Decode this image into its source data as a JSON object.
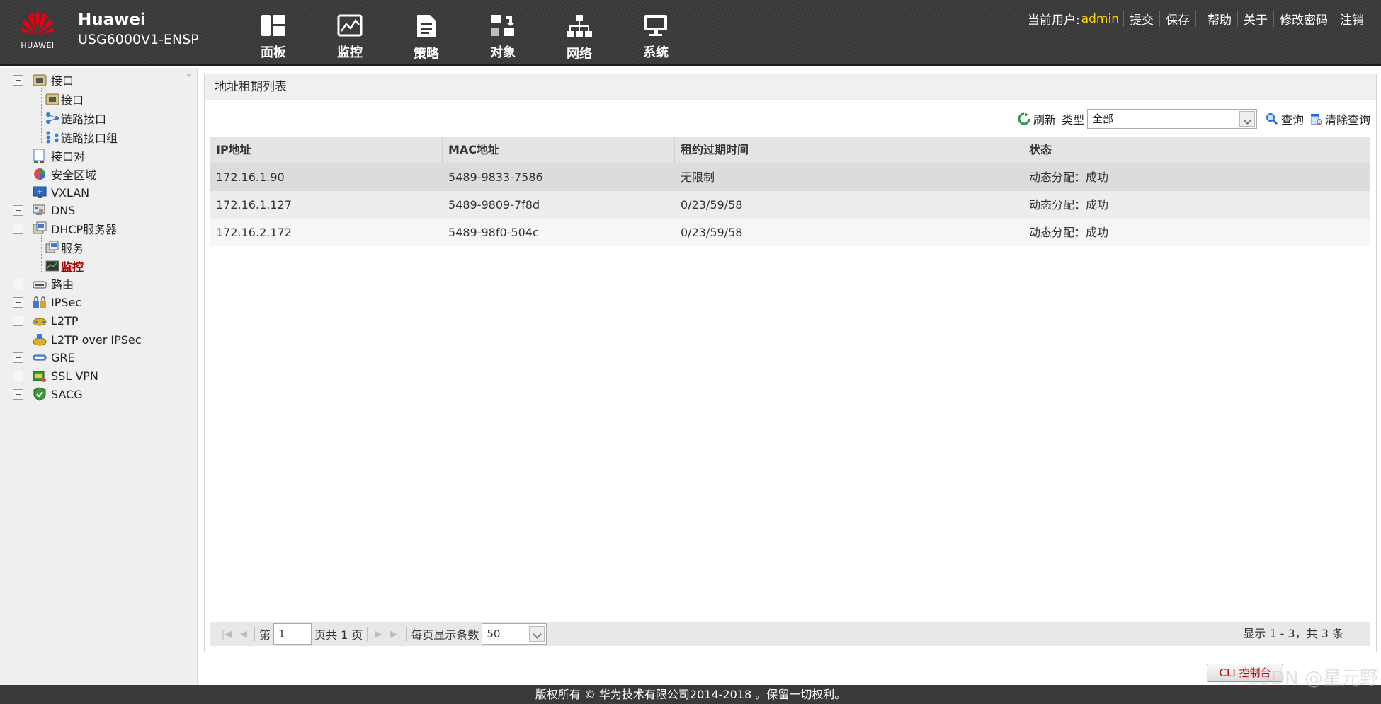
{
  "header": {
    "brand": "Huawei",
    "model": "USG6000V1-ENSP",
    "logo_text": "HUAWEI",
    "nav": [
      {
        "label": "面板",
        "icon": "dashboard-icon"
      },
      {
        "label": "监控",
        "icon": "monitor-icon"
      },
      {
        "label": "策略",
        "icon": "policy-icon"
      },
      {
        "label": "对象",
        "icon": "object-icon"
      },
      {
        "label": "网络",
        "icon": "network-icon"
      },
      {
        "label": "系统",
        "icon": "system-icon"
      }
    ],
    "user_prefix": "当前用户:",
    "user_name": "admin",
    "actions": {
      "submit": "提交",
      "save": "保存",
      "help": "帮助",
      "about": "关于",
      "change_password": "修改密码",
      "logout": "注销"
    },
    "colors": {
      "user_name": "#ffd200",
      "bar": "#3a3a3a"
    }
  },
  "sidebar": {
    "items": [
      {
        "label": "接口",
        "icon": "interface-icon",
        "expander": "minus"
      },
      {
        "label": "接口",
        "icon": "interface-icon"
      },
      {
        "label": "链路接口",
        "icon": "link-interface-icon"
      },
      {
        "label": "链路接口组",
        "icon": "link-group-icon"
      },
      {
        "label": "接口对",
        "icon": "interface-pair-icon"
      },
      {
        "label": "安全区域",
        "icon": "security-zone-icon"
      },
      {
        "label": "VXLAN",
        "icon": "vxlan-icon"
      },
      {
        "label": "DNS",
        "icon": "dns-icon",
        "expander": "plus"
      },
      {
        "label": "DHCP服务器",
        "icon": "dhcp-server-icon",
        "expander": "minus"
      },
      {
        "label": "服务",
        "icon": "service-icon"
      },
      {
        "label": "监控",
        "icon": "monitor-icon",
        "active": true
      },
      {
        "label": "路由",
        "icon": "route-icon",
        "expander": "plus"
      },
      {
        "label": "IPSec",
        "icon": "ipsec-icon",
        "expander": "plus"
      },
      {
        "label": "L2TP",
        "icon": "l2tp-icon",
        "expander": "plus"
      },
      {
        "label": "L2TP over IPSec",
        "icon": "l2tp-ipsec-icon"
      },
      {
        "label": "GRE",
        "icon": "gre-icon",
        "expander": "plus"
      },
      {
        "label": "SSL VPN",
        "icon": "ssl-vpn-icon",
        "expander": "plus"
      },
      {
        "label": "SACG",
        "icon": "sacg-icon",
        "expander": "plus"
      }
    ]
  },
  "main": {
    "panel_title": "地址租期列表",
    "toolbar": {
      "refresh": "刷新",
      "type_label": "类型",
      "type_value": "全部",
      "query": "查询",
      "clear_query": "清除查询"
    },
    "table": {
      "columns": [
        "IP地址",
        "MAC地址",
        "租约过期时间",
        "状态"
      ],
      "rows": [
        [
          "172.16.1.90",
          "5489-9833-7586",
          "无限制",
          "动态分配：成功"
        ],
        [
          "172.16.1.127",
          "5489-9809-7f8d",
          "0/23/59/58",
          "动态分配：成功"
        ],
        [
          "172.16.2.172",
          "5489-98f0-504c",
          "0/23/59/58",
          "动态分配：成功"
        ]
      ]
    },
    "pager": {
      "page_prefix": "第",
      "page_value": "1",
      "page_suffix": "页共 1 页",
      "per_page_label": "每页显示条数",
      "per_page_value": "50",
      "summary": "显示 1 - 3，共 3 条"
    }
  },
  "cli_button": "CLI 控制台",
  "footer": "版权所有 © 华为技术有限公司2014-2018 。保留一切权利。",
  "watermark": "CSDN @星元野"
}
